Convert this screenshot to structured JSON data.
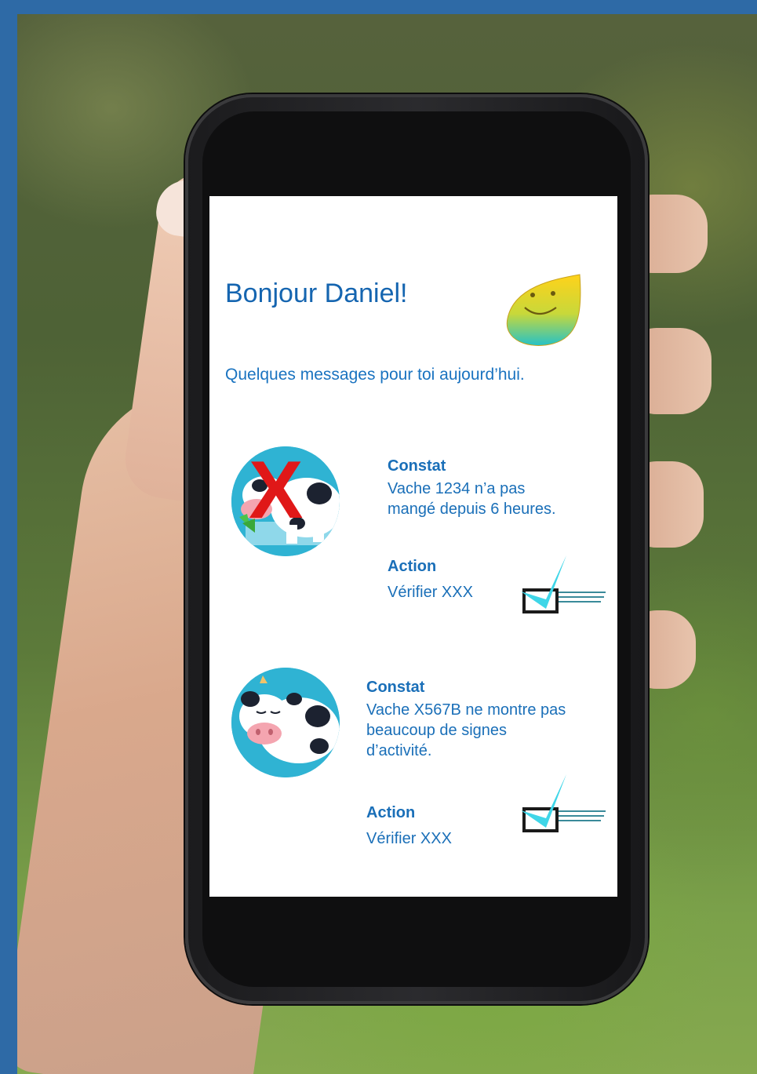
{
  "screen": {
    "greeting": "Bonjour Daniel!",
    "subtitle": "Quelques messages pour toi aujourd’hui."
  },
  "messages": [
    {
      "finding_label": "Constat",
      "finding_text_line1": "Vache 1234 n’a pas",
      "finding_text_line2": "mangé depuis 6 heures.",
      "action_label": "Action",
      "action_text": "Vérifier XXX",
      "image_icon": "cow-eating-crossed-icon",
      "marker": "X"
    },
    {
      "finding_label": "Constat",
      "finding_text_line1": "Vache X567B ne montre pas",
      "finding_text_line2": "beaucoup de signes",
      "finding_text_line3": "d’activité.",
      "action_label": "Action",
      "action_text": "Vérifier XXX",
      "image_icon": "cow-sleeping-icon"
    }
  ],
  "colors": {
    "frame_blue": "#2e6aa6",
    "text_blue": "#1a6fb8",
    "cow_circle": "#2fb3d3",
    "check_cyan": "#3fd6e8",
    "cross_red": "#e01818"
  }
}
